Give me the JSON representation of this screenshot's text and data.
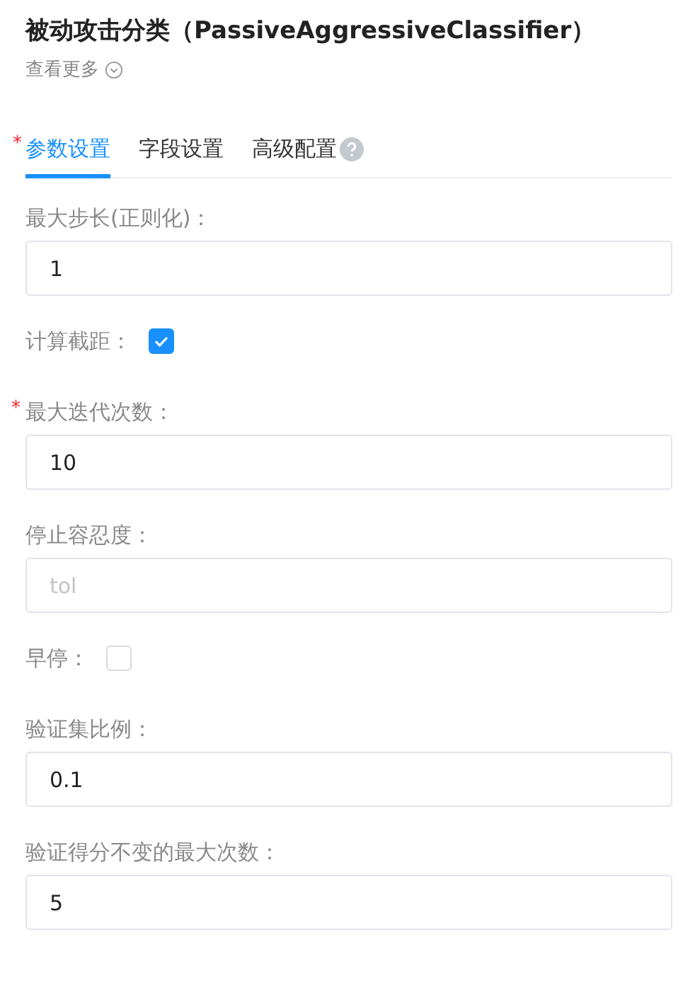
{
  "title": "被动攻击分类（PassiveAggressiveClassifier）",
  "more_link": "查看更多",
  "tabs": [
    {
      "label": "参数设置",
      "selected": true,
      "required_mark": "*",
      "help": false
    },
    {
      "label": "字段设置",
      "selected": false,
      "help": false
    },
    {
      "label": "高级配置",
      "selected": false,
      "help": true
    }
  ],
  "fields": [
    {
      "kind": "text",
      "label": "最大步长(正则化)：",
      "value": "1"
    },
    {
      "kind": "checkbox",
      "label": "计算截距：",
      "checked": true
    },
    {
      "kind": "text",
      "label": "最大迭代次数：",
      "required_mark": "*",
      "value": "10"
    },
    {
      "kind": "text",
      "label": "停止容忍度：",
      "placeholder": "tol"
    },
    {
      "kind": "checkbox",
      "label": "早停：",
      "checked": false
    },
    {
      "kind": "text",
      "label": "验证集比例：",
      "value": "0.1"
    },
    {
      "kind": "text",
      "label": "验证得分不变的最大次数：",
      "value": "5"
    }
  ]
}
